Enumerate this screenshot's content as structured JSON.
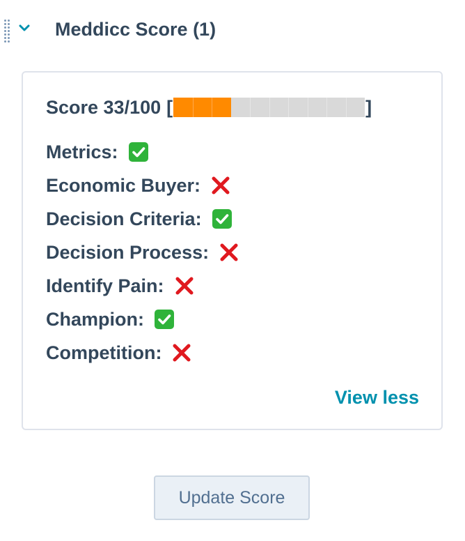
{
  "section": {
    "title": "Meddicc Score (1)"
  },
  "score": {
    "label": "Score 33/100",
    "open_bracket": "[",
    "close_bracket": "]",
    "filled_segments": 3,
    "total_segments": 10,
    "filled_color": "#ff8a00",
    "empty_color": "#d9d9d9"
  },
  "criteria": [
    {
      "label": "Metrics:",
      "status": "check-icon"
    },
    {
      "label": "Economic Buyer:",
      "status": "cross-icon"
    },
    {
      "label": "Decision Criteria:",
      "status": "check-icon"
    },
    {
      "label": "Decision Process:",
      "status": "cross-icon"
    },
    {
      "label": "Identify Pain:",
      "status": "cross-icon"
    },
    {
      "label": "Champion:",
      "status": "check-icon"
    },
    {
      "label": "Competition:",
      "status": "cross-icon"
    }
  ],
  "actions": {
    "view_less": "View less",
    "update_score": "Update Score"
  },
  "colors": {
    "text": "#33475b",
    "link": "#0091ae",
    "check": "#2fb33a",
    "cross": "#e0191f"
  }
}
